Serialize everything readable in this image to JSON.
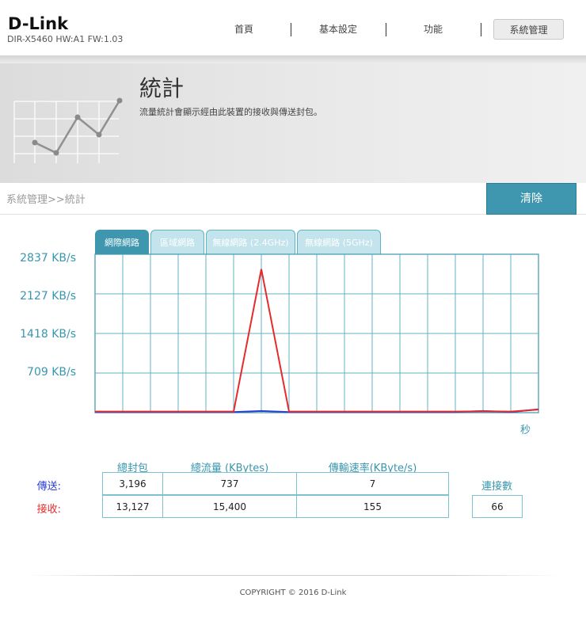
{
  "header": {
    "logo": "D-Link",
    "model": "DIR-X5460 HW:A1 FW:1.03",
    "nav": [
      {
        "label": "首頁"
      },
      {
        "label": "基本設定"
      },
      {
        "label": "功能"
      },
      {
        "label": "系統管理",
        "active": true
      }
    ]
  },
  "banner": {
    "title": "統計",
    "description": "流量統計會顯示經由此裝置的接收與傳送封包。",
    "icon": "line-chart-icon"
  },
  "breadcrumb": "系統管理>>統計",
  "clear_button": "清除",
  "tabs": [
    {
      "label": "網際網路",
      "active": true
    },
    {
      "label": "區域網路"
    },
    {
      "label": "無線網路 (2.4GHz)"
    },
    {
      "label": "無線網路 (5GHz)"
    }
  ],
  "chart_data": {
    "type": "line",
    "title": "",
    "xlabel": "秒",
    "ylabel": "",
    "y_ticks": [
      "2837 KB/s",
      "2127 KB/s",
      "1418 KB/s",
      "709 KB/s"
    ],
    "ylim": [
      0,
      2837
    ],
    "grid": true,
    "x": [
      0,
      1,
      2,
      3,
      4,
      5,
      6,
      7,
      8,
      9,
      10,
      11,
      12,
      13,
      14,
      15,
      16
    ],
    "series": [
      {
        "color": "#e52b2b",
        "values": [
          20,
          20,
          20,
          20,
          20,
          20,
          2570,
          20,
          20,
          20,
          20,
          20,
          20,
          20,
          25,
          20,
          55
        ]
      },
      {
        "color": "#2b3fd6",
        "values": [
          12,
          12,
          12,
          12,
          12,
          12,
          30,
          12,
          12,
          12,
          12,
          12,
          12,
          12,
          30,
          12,
          60
        ]
      }
    ],
    "color_accent": "#3e97ae"
  },
  "stats": {
    "columns": [
      "總封包",
      "總流量 (KBytes)",
      "傳輸速率(KByte/s)"
    ],
    "rows": [
      {
        "label": "傳送:",
        "color": "#2b3fd6",
        "values": [
          "3,196",
          "737",
          "7"
        ]
      },
      {
        "label": "接收:",
        "color": "#e52b2b",
        "values": [
          "13,127",
          "15,400",
          "155"
        ]
      }
    ],
    "connections_label": "連接數",
    "connections_value": "66"
  },
  "footer": "COPYRIGHT © 2016 D-Link"
}
